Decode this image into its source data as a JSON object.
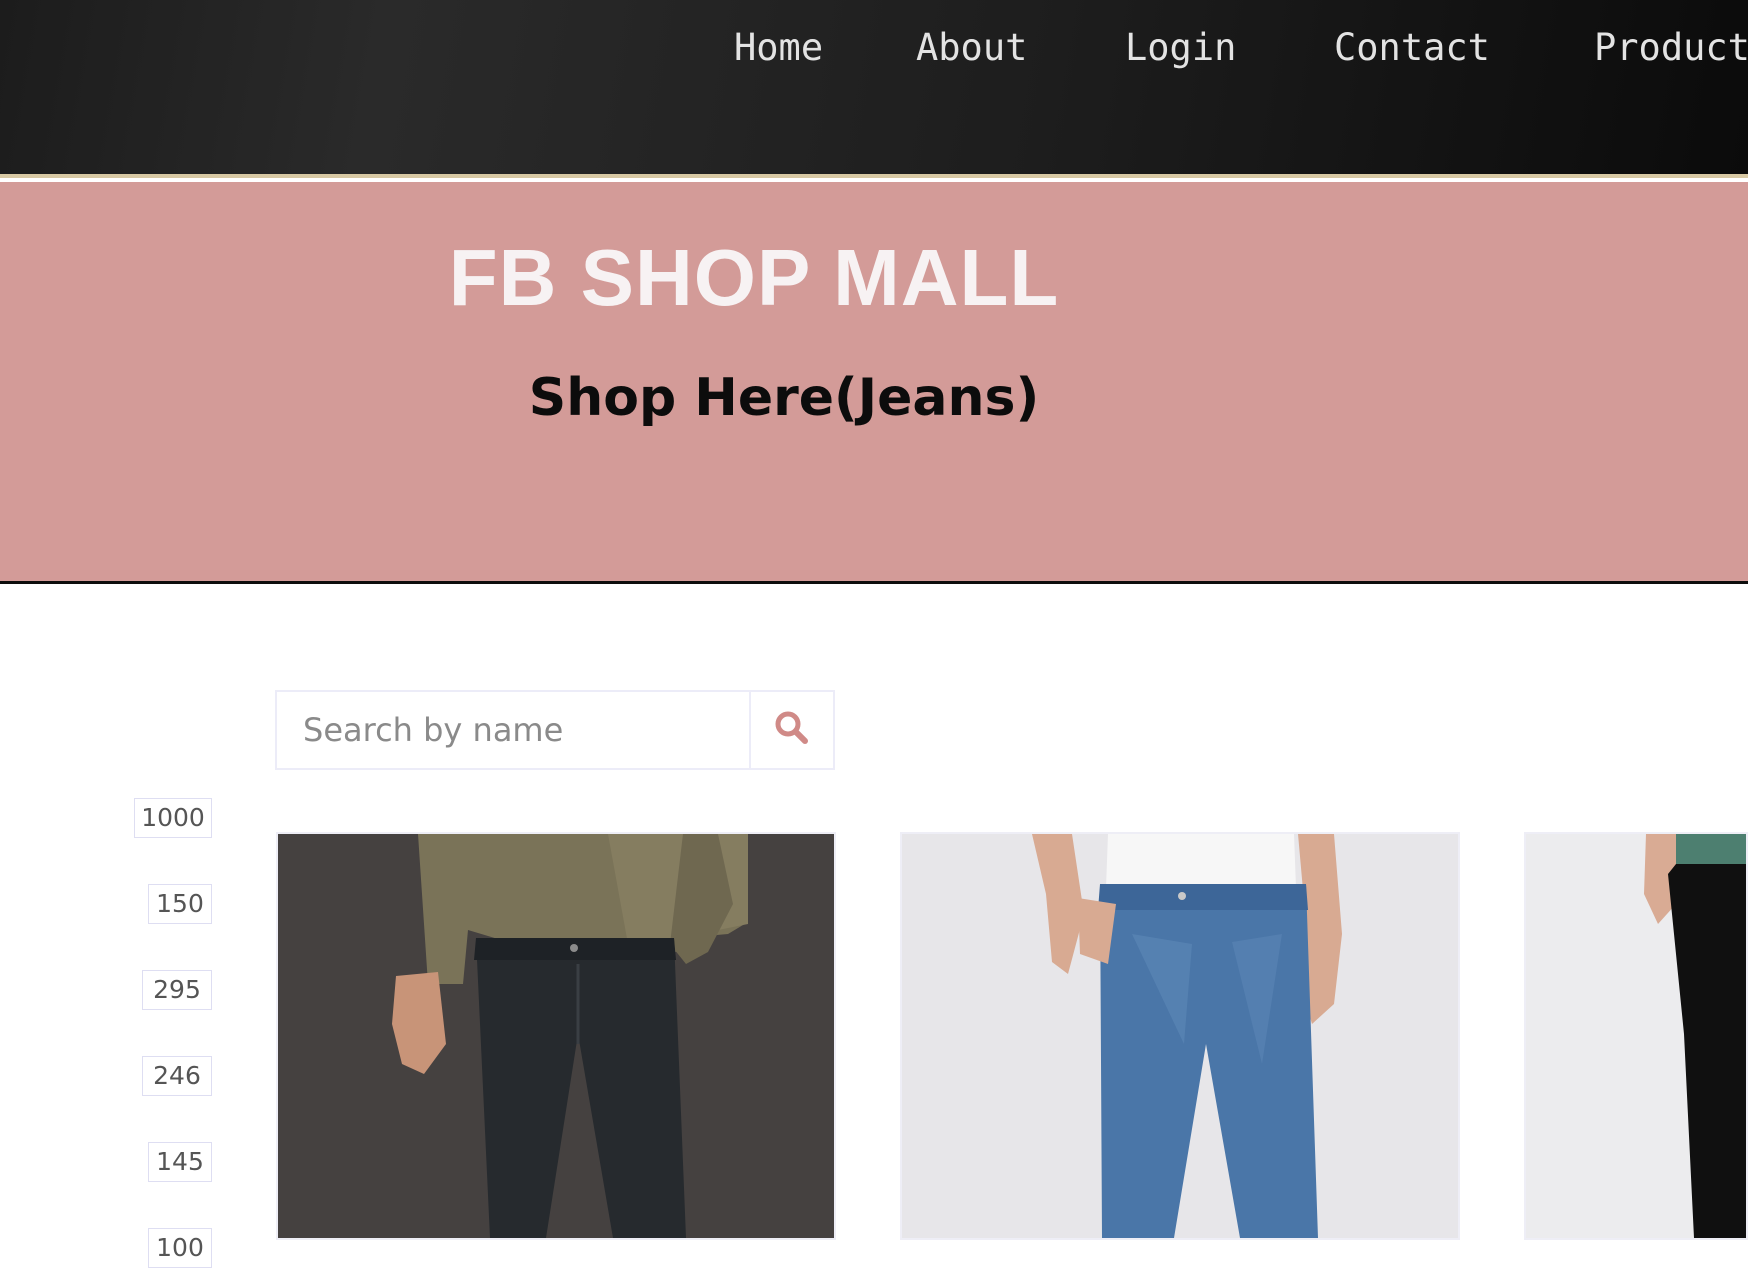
{
  "nav": {
    "items": [
      "Home",
      "About",
      "Login",
      "Contact",
      "Products"
    ]
  },
  "hero": {
    "title": "FB SHOP MALL",
    "subtitle": "Shop Here(Jeans)"
  },
  "search": {
    "placeholder": "Search by name",
    "icon": "search-icon"
  },
  "price_filters": [
    "1000",
    "150",
    "295",
    "246",
    "145",
    "100"
  ],
  "colors": {
    "nav_bg": "#1d1d1d",
    "hero_bg": "#d39b98",
    "accent": "#d08a87"
  },
  "products": [
    {
      "image": "jeans-dark-model-photo"
    },
    {
      "image": "jeans-blue-model-photo"
    },
    {
      "image": "jeans-black-model-photo"
    }
  ]
}
